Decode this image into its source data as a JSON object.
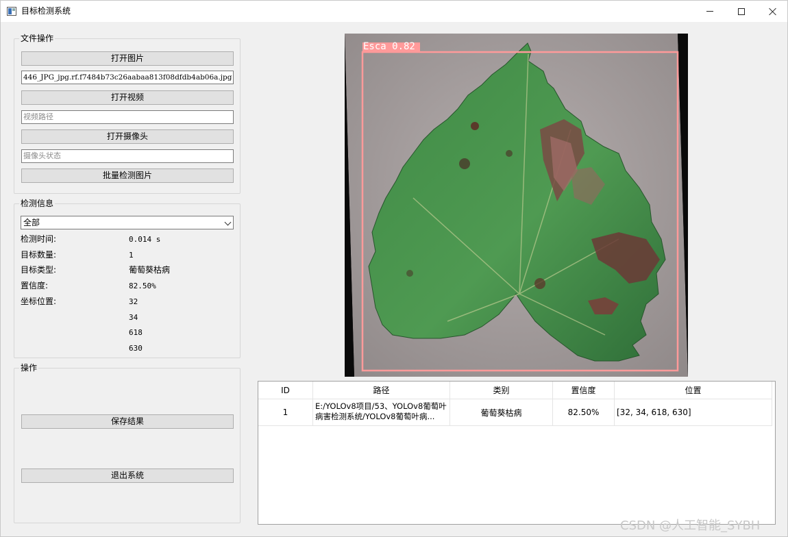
{
  "window": {
    "title": "目标检测系统"
  },
  "file_ops": {
    "group_title": "文件操作",
    "open_image_label": "打开图片",
    "image_path_value": "446_JPG_jpg.rf.f7484b73c26aabaa813f08dfdb4ab06a.jpg",
    "open_video_label": "打开视频",
    "video_path_placeholder": "视频路径",
    "open_camera_label": "打开摄像头",
    "camera_status_placeholder": "摄像头状态",
    "batch_detect_label": "批量检测图片"
  },
  "detect_info": {
    "group_title": "检测信息",
    "select_value": "全部",
    "time_label": "检测时间:",
    "time_value": "0.014 s",
    "count_label": "目标数量:",
    "count_value": "1",
    "type_label": "目标类型:",
    "type_value": "葡萄葵枯病",
    "conf_label": "置信度:",
    "conf_value": "82.50%",
    "coord_label": "坐标位置:",
    "coords": [
      "32",
      "34",
      "618",
      "630"
    ]
  },
  "operations": {
    "group_title": "操作",
    "save_label": "保存结果",
    "exit_label": "退出系统"
  },
  "detection": {
    "label_text": "Esca 0.82",
    "box_color": "#ff9a9a"
  },
  "table": {
    "headers": [
      "ID",
      "路径",
      "类别",
      "置信度",
      "位置"
    ],
    "rows": [
      {
        "id": "1",
        "path": "E:/YOLOv8项目/53、YOLOv8葡萄叶病害检测系统/YOLOv8葡萄叶病...",
        "class": "葡萄葵枯病",
        "conf": "82.50%",
        "pos": "[32, 34, 618, 630]"
      }
    ]
  },
  "watermark": "CSDN @人工智能_SYBH",
  "icons": {
    "app": "app-window-icon",
    "minimize": "minimize-icon",
    "maximize": "maximize-icon",
    "close": "close-icon",
    "dropdown": "chevron-down-icon"
  }
}
